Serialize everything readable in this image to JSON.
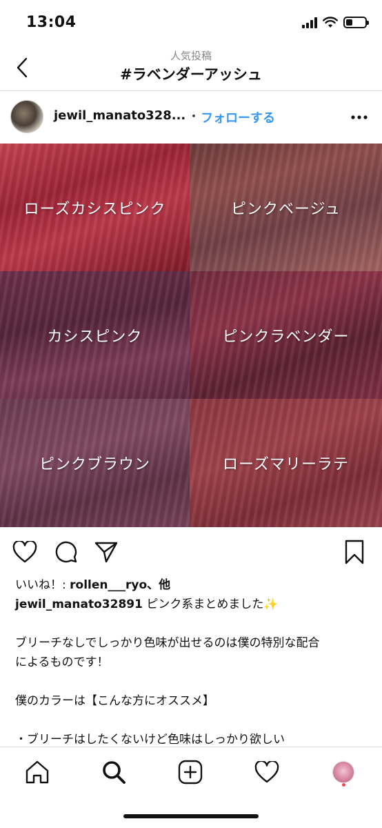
{
  "status_bar": {
    "time": "13:04"
  },
  "header": {
    "subtitle": "人気投稿",
    "title": "#ラベンダーアッシュ"
  },
  "post": {
    "username": "jewil_manato328...",
    "separator": "・",
    "follow_label": "フォローする"
  },
  "photo": {
    "tiles": [
      {
        "label": "ローズカシスピンク"
      },
      {
        "label": "ピンクベージュ"
      },
      {
        "label": "カシスピンク"
      },
      {
        "label": "ピンクラベンダー"
      },
      {
        "label": "ピンクブラウン"
      },
      {
        "label": "ローズマリーラテ"
      }
    ]
  },
  "caption": {
    "likes_prefix": "いいね！: ",
    "likes_user": "rollen___ryo",
    "likes_suffix": "、他",
    "author": "jewil_manato32891",
    "text_first": " ピンク系まとめました✨",
    "line1": "ブリーチなしでしっかり色味が出せるのは僕の特別な配合",
    "line2": "によるものです！",
    "line3": "僕のカラーは【こんな方にオススメ】",
    "line4": "・ブリーチはしたくないけど色味はしっかり欲しい"
  },
  "colors": {
    "link_blue": "#3897f0",
    "notification_red": "#ed4956"
  },
  "icons": [
    "back-chevron-icon",
    "more-icon",
    "heart-icon",
    "comment-icon",
    "share-icon",
    "bookmark-icon",
    "home-icon",
    "search-icon",
    "add-icon",
    "activity-icon",
    "profile-icon"
  ]
}
